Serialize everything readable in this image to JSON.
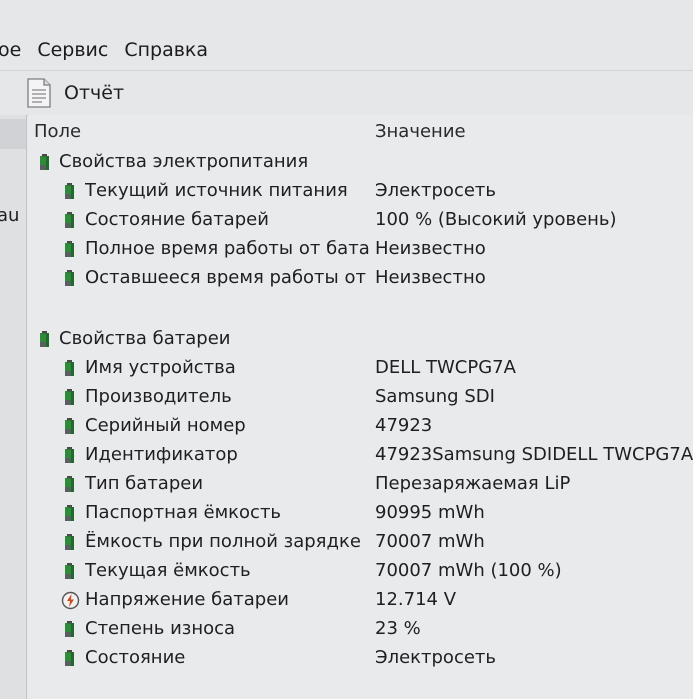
{
  "menu": {
    "partial": "ое",
    "service": "Сервис",
    "help": "Справка"
  },
  "toolbar": {
    "report_label": "Отчёт"
  },
  "left_panel": {
    "partial_text": "au"
  },
  "columns": {
    "field": "Поле",
    "value": "Значение"
  },
  "icons": {
    "battery": "battery-icon",
    "voltage": "voltage-icon",
    "report": "document-icon"
  },
  "colors": {
    "battery_green": "#2f8a3a",
    "voltage_orange": "#d24a1c"
  },
  "power_group": {
    "title": "Свойства электропитания",
    "items": [
      {
        "field": "Текущий источник питания",
        "value": "Электросеть"
      },
      {
        "field": "Состояние батарей",
        "value": "100 % (Высокий уровень)"
      },
      {
        "field": "Полное время работы от бата...",
        "value": "Неизвестно"
      },
      {
        "field": "Оставшееся время работы от ...",
        "value": "Неизвестно"
      }
    ]
  },
  "battery_group": {
    "title": "Свойства батареи",
    "items": [
      {
        "field": "Имя устройства",
        "value": "DELL TWCPG7A"
      },
      {
        "field": "Производитель",
        "value": "Samsung SDI"
      },
      {
        "field": "Серийный номер",
        "value": "47923"
      },
      {
        "field": "Идентификатор",
        "value": "47923Samsung SDIDELL TWCPG7A"
      },
      {
        "field": "Тип батареи",
        "value": "Перезаряжаемая LiP"
      },
      {
        "field": "Паспортная ёмкость",
        "value": "90995 mWh"
      },
      {
        "field": "Ёмкость при полной зарядке",
        "value": "70007 mWh"
      },
      {
        "field": "Текущая ёмкость",
        "value": "70007 mWh  (100 %)"
      },
      {
        "field": "Напряжение батареи",
        "value": "12.714 V"
      },
      {
        "field": "Степень износа",
        "value": "23 %"
      },
      {
        "field": "Состояние",
        "value": "Электросеть"
      }
    ]
  }
}
